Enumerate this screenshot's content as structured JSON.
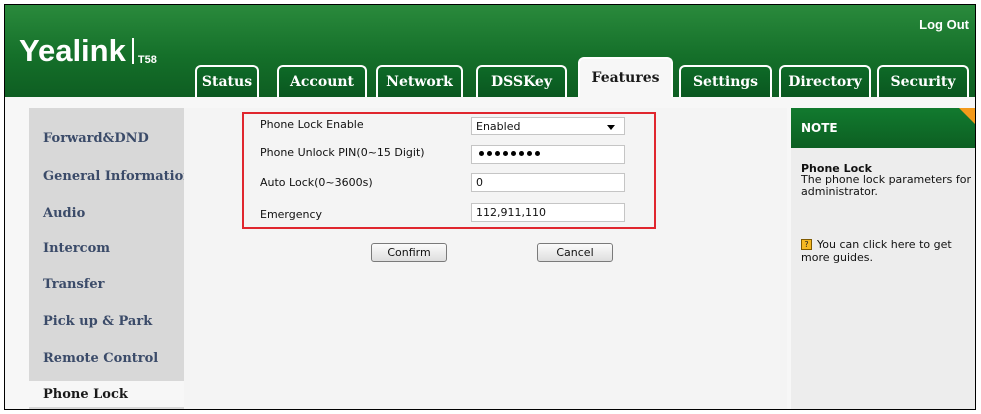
{
  "header": {
    "logo_text": "Yealink",
    "logo_model": "T58",
    "logout_label": "Log Out"
  },
  "tabs": [
    {
      "label": "Status"
    },
    {
      "label": "Account"
    },
    {
      "label": "Network"
    },
    {
      "label": "DSSKey"
    },
    {
      "label": "Features",
      "active": true
    },
    {
      "label": "Settings"
    },
    {
      "label": "Directory"
    },
    {
      "label": "Security"
    }
  ],
  "sidebar": {
    "items": [
      {
        "label": "Forward&DND"
      },
      {
        "label": "General Information"
      },
      {
        "label": "Audio"
      },
      {
        "label": "Intercom"
      },
      {
        "label": "Transfer"
      },
      {
        "label": "Pick up & Park"
      },
      {
        "label": "Remote Control"
      },
      {
        "label": "Phone Lock",
        "active": true
      }
    ]
  },
  "form": {
    "phone_lock_enable": {
      "label": "Phone Lock Enable",
      "value": "Enabled"
    },
    "unlock_pin": {
      "label": "Phone Unlock PIN(0~15 Digit)",
      "value_masked_dots": 8
    },
    "auto_lock": {
      "label": "Auto Lock(0~3600s)",
      "value": "0"
    },
    "emergency": {
      "label": "Emergency",
      "value": "112,911,110"
    },
    "confirm_label": "Confirm",
    "cancel_label": "Cancel"
  },
  "note": {
    "header": "NOTE",
    "title": "Phone Lock",
    "text": "The phone lock parameters for administrator.",
    "guide_text": "You can click here to get more guides."
  },
  "colors": {
    "header_green": "#15702a",
    "highlight_red": "#e0262e",
    "note_corner": "#f39a1b",
    "menu_text": "#3b4b69"
  }
}
